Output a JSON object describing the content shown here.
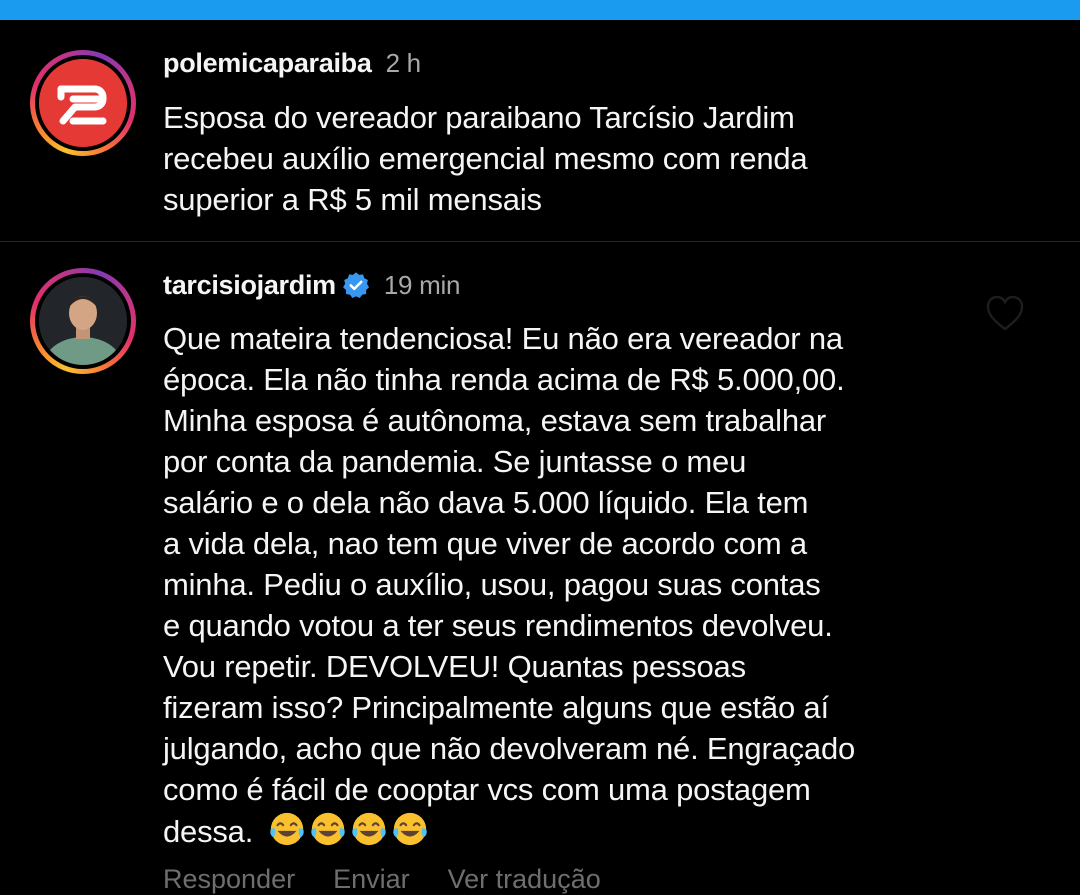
{
  "post": {
    "username": "polemicaparaiba",
    "timestamp": "2 h",
    "text_lines": [
      "Esposa do vereador paraibano Tarcísio Jardim",
      "recebeu auxílio emergencial mesmo com renda",
      "superior a R$ 5 mil mensais"
    ]
  },
  "comment": {
    "username": "tarcisiojardim",
    "timestamp": "19 min",
    "text_lines": [
      "Que mateira tendenciosa! Eu não era vereador na",
      "época. Ela não tinha renda acima de R$ 5.000,00.",
      "Minha esposa é autônoma, estava sem trabalhar",
      "por conta da pandemia. Se juntasse o meu",
      "salário  e o dela não dava 5.000 líquido. Ela tem",
      "a vida dela, nao tem que viver de acordo com a",
      "minha. Pediu o auxílio, usou, pagou suas contas",
      "e quando votou a ter seus rendimentos devolveu.",
      "Vou repetir. DEVOLVEU! Quantas pessoas",
      "fizeram isso? Principalmente alguns que estão aí",
      "julgando, acho que não devolveram né. Engraçado",
      "como é fácil de cooptar vcs com uma postagem",
      "dessa."
    ],
    "emoji": [
      "face-with-tears-of-joy-icon",
      "face-with-tears-of-joy-icon",
      "face-with-tears-of-joy-icon",
      "face-with-tears-of-joy-icon"
    ]
  },
  "actions": {
    "reply": "Responder",
    "send": "Enviar",
    "translate": "Ver tradução"
  },
  "colors": {
    "top_bar": "#1a9bf0",
    "background": "#000000",
    "text": "#f5f5f5",
    "muted": "#a8a8a8",
    "verified": "#3897f0"
  }
}
